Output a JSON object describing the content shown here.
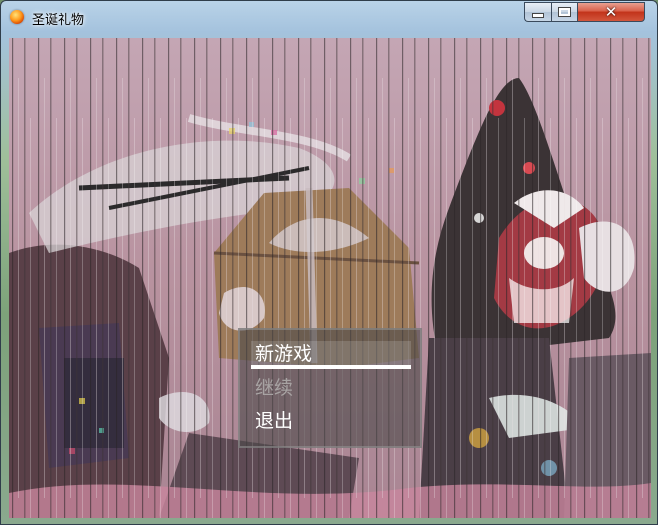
{
  "window": {
    "title": "圣诞礼物",
    "icon": "game-app-icon",
    "controls": {
      "minimize": "minimize-icon",
      "maximize": "maximize-icon",
      "close": "close-icon",
      "close_glyph": "✕"
    }
  },
  "menu": {
    "items": [
      {
        "label": "新游戏",
        "state": "selected"
      },
      {
        "label": "继续",
        "state": "disabled"
      },
      {
        "label": "退出",
        "state": "enabled"
      }
    ]
  },
  "colors": {
    "menu_text": "#ffffff",
    "menu_disabled_text": "#a8a3a3",
    "menu_background": "#4e4a4a",
    "close_button": "#c2331a"
  }
}
